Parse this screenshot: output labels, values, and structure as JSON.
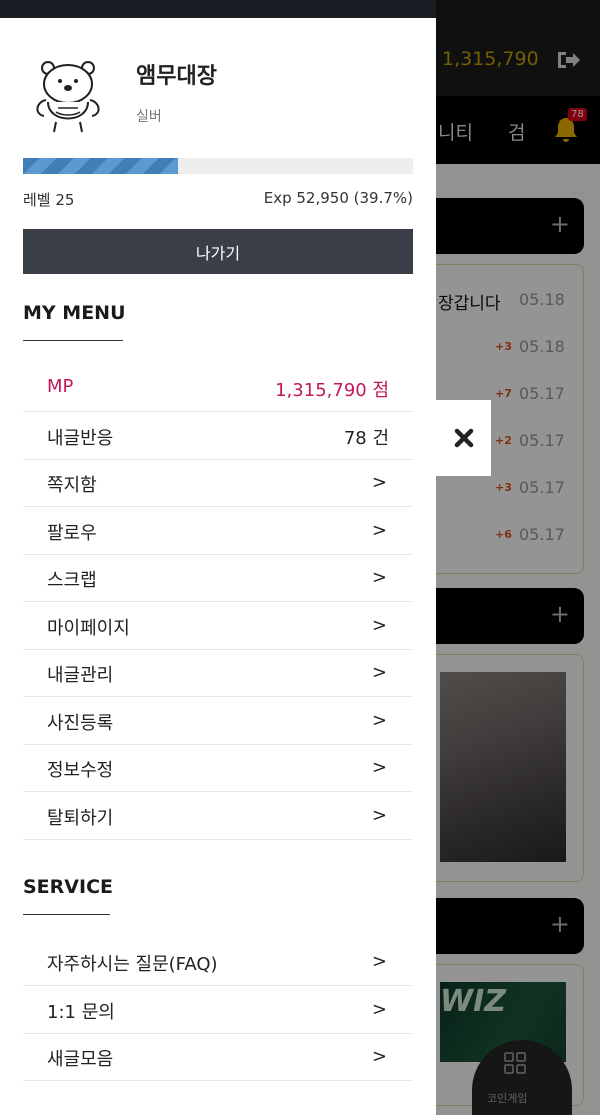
{
  "background": {
    "mp_value": "1,315,790",
    "nav_items": [
      "니티",
      "검"
    ],
    "notification_count": "78",
    "post_title": "장갑니다",
    "post_dates": [
      "05.18",
      "05.18",
      "05.17",
      "05.17",
      "05.17",
      "05.17"
    ],
    "comment_counts": [
      "+3",
      "+7",
      "+2",
      "+3",
      "+6"
    ],
    "banner_text": "WIZ",
    "coin_game_label": "코인게임"
  },
  "profile": {
    "nickname": "앰무대장",
    "grade": "실버",
    "level_label": "레벨 25",
    "exp_label": "Exp 52,950 (39.7%)",
    "exp_progress": 0.397,
    "logout_label": "나가기"
  },
  "my_menu": {
    "title": "MY MENU",
    "items": [
      {
        "label": "MP",
        "value": "1,315,790 점"
      },
      {
        "label": "내글반응",
        "value": "78 건"
      },
      {
        "label": "쪽지함",
        "value": ">"
      },
      {
        "label": "팔로우",
        "value": ">"
      },
      {
        "label": "스크랩",
        "value": ">"
      },
      {
        "label": "마이페이지",
        "value": ">"
      },
      {
        "label": "내글관리",
        "value": ">"
      },
      {
        "label": "사진등록",
        "value": ">"
      },
      {
        "label": "정보수정",
        "value": ">"
      },
      {
        "label": "탈퇴하기",
        "value": ">"
      }
    ]
  },
  "service": {
    "title": "SERVICE",
    "items": [
      {
        "label": "자주하시는 질문(FAQ)",
        "value": ">"
      },
      {
        "label": "1:1 문의",
        "value": ">"
      },
      {
        "label": "새글모음",
        "value": ">"
      }
    ]
  },
  "colors": {
    "drawer_bg": "#ffffff",
    "logout_button": "#3a3f47",
    "mp_accent": "#c2185b",
    "progress": "#3f7fb5"
  }
}
